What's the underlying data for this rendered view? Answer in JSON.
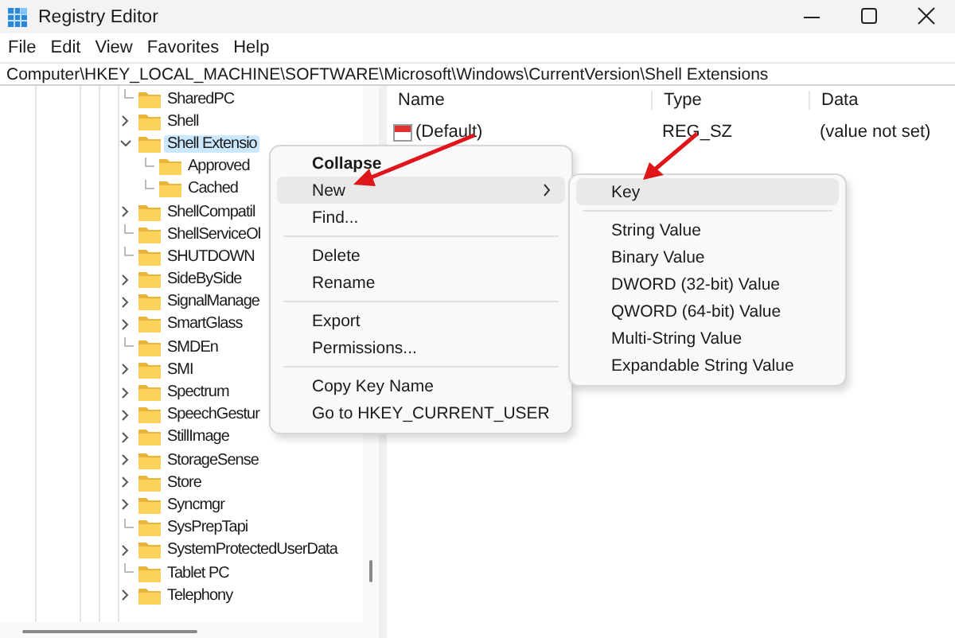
{
  "window": {
    "title": "Registry Editor"
  },
  "menu_bar": [
    "File",
    "Edit",
    "View",
    "Favorites",
    "Help"
  ],
  "address": "Computer\\HKEY_LOCAL_MACHINE\\SOFTWARE\\Microsoft\\Windows\\CurrentVersion\\Shell Extensions",
  "tree": [
    {
      "label": "SharedPC",
      "has_children": false,
      "selected": false
    },
    {
      "label": "Shell",
      "has_children": true,
      "expanded": false,
      "selected": false
    },
    {
      "label": "Shell Extensio",
      "has_children": true,
      "expanded": true,
      "selected": true,
      "children": [
        {
          "label": "Approved",
          "has_children": false,
          "selected": false
        },
        {
          "label": "Cached",
          "has_children": false,
          "selected": false
        }
      ]
    },
    {
      "label": "ShellCompatil",
      "has_children": true,
      "expanded": false,
      "selected": false
    },
    {
      "label": "ShellServiceOl",
      "has_children": false,
      "selected": false
    },
    {
      "label": "SHUTDOWN",
      "has_children": false,
      "selected": false
    },
    {
      "label": "SideBySide",
      "has_children": true,
      "expanded": false,
      "selected": false
    },
    {
      "label": "SignalManage",
      "has_children": true,
      "expanded": false,
      "selected": false
    },
    {
      "label": "SmartGlass",
      "has_children": true,
      "expanded": false,
      "selected": false
    },
    {
      "label": "SMDEn",
      "has_children": false,
      "selected": false
    },
    {
      "label": "SMI",
      "has_children": true,
      "expanded": false,
      "selected": false
    },
    {
      "label": "Spectrum",
      "has_children": true,
      "expanded": false,
      "selected": false
    },
    {
      "label": "SpeechGestur",
      "has_children": true,
      "expanded": false,
      "selected": false
    },
    {
      "label": "StillImage",
      "has_children": true,
      "expanded": false,
      "selected": false
    },
    {
      "label": "StorageSense",
      "has_children": true,
      "expanded": false,
      "selected": false
    },
    {
      "label": "Store",
      "has_children": true,
      "expanded": false,
      "selected": false
    },
    {
      "label": "Syncmgr",
      "has_children": true,
      "expanded": false,
      "selected": false
    },
    {
      "label": "SysPrepTapi",
      "has_children": false,
      "selected": false
    },
    {
      "label": "SystemProtectedUserData",
      "has_children": true,
      "expanded": false,
      "selected": false
    },
    {
      "label": "Tablet PC",
      "has_children": false,
      "selected": false
    },
    {
      "label": "Telephony",
      "has_children": true,
      "expanded": false,
      "selected": false
    }
  ],
  "values_table": {
    "columns": [
      "Name",
      "Type",
      "Data"
    ],
    "rows": [
      {
        "name": "(Default)",
        "type": "REG_SZ",
        "data": "(value not set)"
      }
    ]
  },
  "context_menu": {
    "groups": [
      [
        {
          "label": "Collapse",
          "default": true,
          "highlighted": false,
          "submenu": false
        },
        {
          "label": "New",
          "default": false,
          "highlighted": true,
          "submenu": true
        },
        {
          "label": "Find...",
          "default": false,
          "highlighted": false,
          "submenu": false
        }
      ],
      [
        {
          "label": "Delete",
          "default": false,
          "highlighted": false,
          "submenu": false
        },
        {
          "label": "Rename",
          "default": false,
          "highlighted": false,
          "submenu": false
        }
      ],
      [
        {
          "label": "Export",
          "default": false,
          "highlighted": false,
          "submenu": false
        },
        {
          "label": "Permissions...",
          "default": false,
          "highlighted": false,
          "submenu": false
        }
      ],
      [
        {
          "label": "Copy Key Name",
          "default": false,
          "highlighted": false,
          "submenu": false
        },
        {
          "label": "Go to HKEY_CURRENT_USER",
          "default": false,
          "highlighted": false,
          "submenu": false
        }
      ]
    ]
  },
  "submenu": {
    "groups": [
      [
        {
          "label": "Key",
          "default": false,
          "highlighted": true,
          "submenu": false
        }
      ],
      [
        {
          "label": "String Value",
          "default": false,
          "highlighted": false,
          "submenu": false
        },
        {
          "label": "Binary Value",
          "default": false,
          "highlighted": false,
          "submenu": false
        },
        {
          "label": "DWORD (32-bit) Value",
          "default": false,
          "highlighted": false,
          "submenu": false
        },
        {
          "label": "QWORD (64-bit) Value",
          "default": false,
          "highlighted": false,
          "submenu": false
        },
        {
          "label": "Multi-String Value",
          "default": false,
          "highlighted": false,
          "submenu": false
        },
        {
          "label": "Expandable String Value",
          "default": false,
          "highlighted": false,
          "submenu": false
        }
      ]
    ]
  }
}
